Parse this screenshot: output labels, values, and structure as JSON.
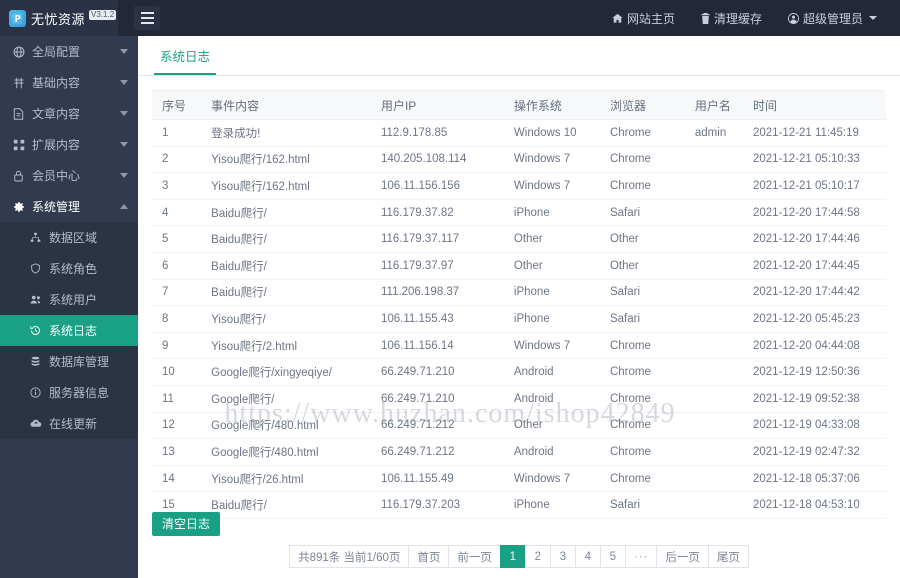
{
  "topbar": {
    "logo_text": "无忧资源",
    "version_badge": "V3.1.2",
    "logo_icon": "p-logo-icon",
    "menu_toggle_icon": "hamburger-icon",
    "right_items": [
      {
        "label": "网站主页",
        "icon": "home-icon"
      },
      {
        "label": "清理缓存",
        "icon": "trash-icon"
      },
      {
        "label": "超级管理员",
        "icon": "user-circle-icon",
        "has_caret": true
      }
    ]
  },
  "sidebar": {
    "items": [
      {
        "label": "全局配置",
        "icon": "globe-icon",
        "expanded": false
      },
      {
        "label": "基础内容",
        "icon": "layers-icon",
        "expanded": false
      },
      {
        "label": "文章内容",
        "icon": "document-icon",
        "expanded": false
      },
      {
        "label": "扩展内容",
        "icon": "puzzle-icon",
        "expanded": false
      },
      {
        "label": "会员中心",
        "icon": "lock-icon",
        "expanded": false
      },
      {
        "label": "系统管理",
        "icon": "gear-icon",
        "expanded": true
      }
    ],
    "submenu": [
      {
        "label": "数据区域",
        "icon": "sitemap-icon",
        "active": false
      },
      {
        "label": "系统角色",
        "icon": "shield-icon",
        "active": false
      },
      {
        "label": "系统用户",
        "icon": "users-icon",
        "active": false
      },
      {
        "label": "系统日志",
        "icon": "history-icon",
        "active": true
      },
      {
        "label": "数据库管理",
        "icon": "database-icon",
        "active": false
      },
      {
        "label": "服务器信息",
        "icon": "info-icon",
        "active": false
      },
      {
        "label": "在线更新",
        "icon": "cloud-upload-icon",
        "active": false
      }
    ]
  },
  "main": {
    "tab_label": "系统日志",
    "clear_button_label": "清空日志",
    "table": {
      "columns": [
        "序号",
        "事件内容",
        "用户IP",
        "操作系统",
        "浏览器",
        "用户名",
        "时间"
      ],
      "rows": [
        [
          "1",
          "登录成功!",
          "112.9.178.85",
          "Windows 10",
          "Chrome",
          "admin",
          "2021-12-21 11:45:19"
        ],
        [
          "2",
          "Yisou爬行/162.html",
          "140.205.108.114",
          "Windows 7",
          "Chrome",
          "",
          "2021-12-21 05:10:33"
        ],
        [
          "3",
          "Yisou爬行/162.html",
          "106.11.156.156",
          "Windows 7",
          "Chrome",
          "",
          "2021-12-21 05:10:17"
        ],
        [
          "4",
          "Baidu爬行/",
          "116.179.37.82",
          "iPhone",
          "Safari",
          "",
          "2021-12-20 17:44:58"
        ],
        [
          "5",
          "Baidu爬行/",
          "116.179.37.117",
          "Other",
          "Other",
          "",
          "2021-12-20 17:44:46"
        ],
        [
          "6",
          "Baidu爬行/",
          "116.179.37.97",
          "Other",
          "Other",
          "",
          "2021-12-20 17:44:45"
        ],
        [
          "7",
          "Baidu爬行/",
          "111.206.198.37",
          "iPhone",
          "Safari",
          "",
          "2021-12-20 17:44:42"
        ],
        [
          "8",
          "Yisou爬行/",
          "106.11.155.43",
          "iPhone",
          "Safari",
          "",
          "2021-12-20 05:45:23"
        ],
        [
          "9",
          "Yisou爬行/2.html",
          "106.11.156.14",
          "Windows 7",
          "Chrome",
          "",
          "2021-12-20 04:44:08"
        ],
        [
          "10",
          "Google爬行/xingyeqiye/",
          "66.249.71.210",
          "Android",
          "Chrome",
          "",
          "2021-12-19 12:50:36"
        ],
        [
          "11",
          "Google爬行/",
          "66.249.71.210",
          "Android",
          "Chrome",
          "",
          "2021-12-19 09:52:38"
        ],
        [
          "12",
          "Google爬行/480.html",
          "66.249.71.212",
          "Other",
          "Chrome",
          "",
          "2021-12-19 04:33:08"
        ],
        [
          "13",
          "Google爬行/480.html",
          "66.249.71.212",
          "Android",
          "Chrome",
          "",
          "2021-12-19 02:47:32"
        ],
        [
          "14",
          "Yisou爬行/26.html",
          "106.11.155.49",
          "Windows 7",
          "Chrome",
          "",
          "2021-12-18 05:37:06"
        ],
        [
          "15",
          "Baidu爬行/",
          "116.179.37.203",
          "iPhone",
          "Safari",
          "",
          "2021-12-18 04:53:10"
        ]
      ]
    },
    "pagination": {
      "info": "共891条 当前1/60页",
      "first": "首页",
      "prev": "前一页",
      "pages": [
        "1",
        "2",
        "3",
        "4",
        "5"
      ],
      "dots": "···",
      "next": "后一页",
      "last": "尾页",
      "current": "1"
    }
  },
  "watermark": {
    "text": "https://www.huzhan.com/ishop42849"
  },
  "colors": {
    "accent": "#1aa085",
    "topbar_bg": "#222838",
    "sidebar_bg": "#313a4e",
    "submenu_bg": "#2b3345"
  }
}
